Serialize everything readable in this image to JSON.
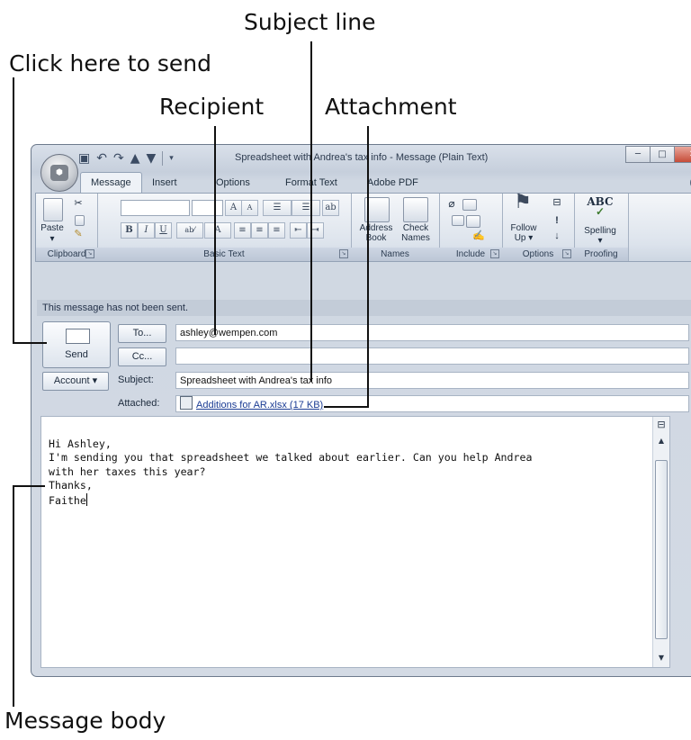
{
  "callouts": {
    "subject_line": "Subject line",
    "click_to_send": "Click here to send",
    "recipient": "Recipient",
    "attachment": "Attachment",
    "message_body": "Message body"
  },
  "window": {
    "title": "Spreadsheet with Andrea's tax info - Message (Plain Text)",
    "tabs": [
      "Message",
      "Insert",
      "Options",
      "Format Text",
      "Adobe PDF"
    ],
    "active_tab": "Message"
  },
  "ribbon": {
    "groups": {
      "clipboard": "Clipboard",
      "basic_text": "Basic Text",
      "names": "Names",
      "include": "Include",
      "options": "Options",
      "proofing": "Proofing"
    },
    "buttons": {
      "paste": "Paste",
      "address_book_1": "Address",
      "address_book_2": "Book",
      "check_names_1": "Check",
      "check_names_2": "Names",
      "follow_up_1": "Follow",
      "follow_up_2": "Up",
      "spelling": "Spelling",
      "bold": "B",
      "italic": "I",
      "underline": "U",
      "spelling_icon": "ABC"
    }
  },
  "message": {
    "notice": "This message has not been sent.",
    "send_label": "Send",
    "to_label": "To...",
    "cc_label": "Cc...",
    "account_label": "Account",
    "subject_label": "Subject:",
    "attached_label": "Attached:",
    "to_value": "ashley@wempen.com",
    "cc_value": "",
    "subject_value": "Spreadsheet with Andrea's tax info",
    "attachment_name": "Additions for AR.xlsx (17 KB)",
    "body_lines": [
      "Hi Ashley,",
      "I'm sending you that spreadsheet we talked about earlier. Can you help Andrea",
      "with her taxes this year?",
      "Thanks,",
      "Faithe"
    ]
  }
}
